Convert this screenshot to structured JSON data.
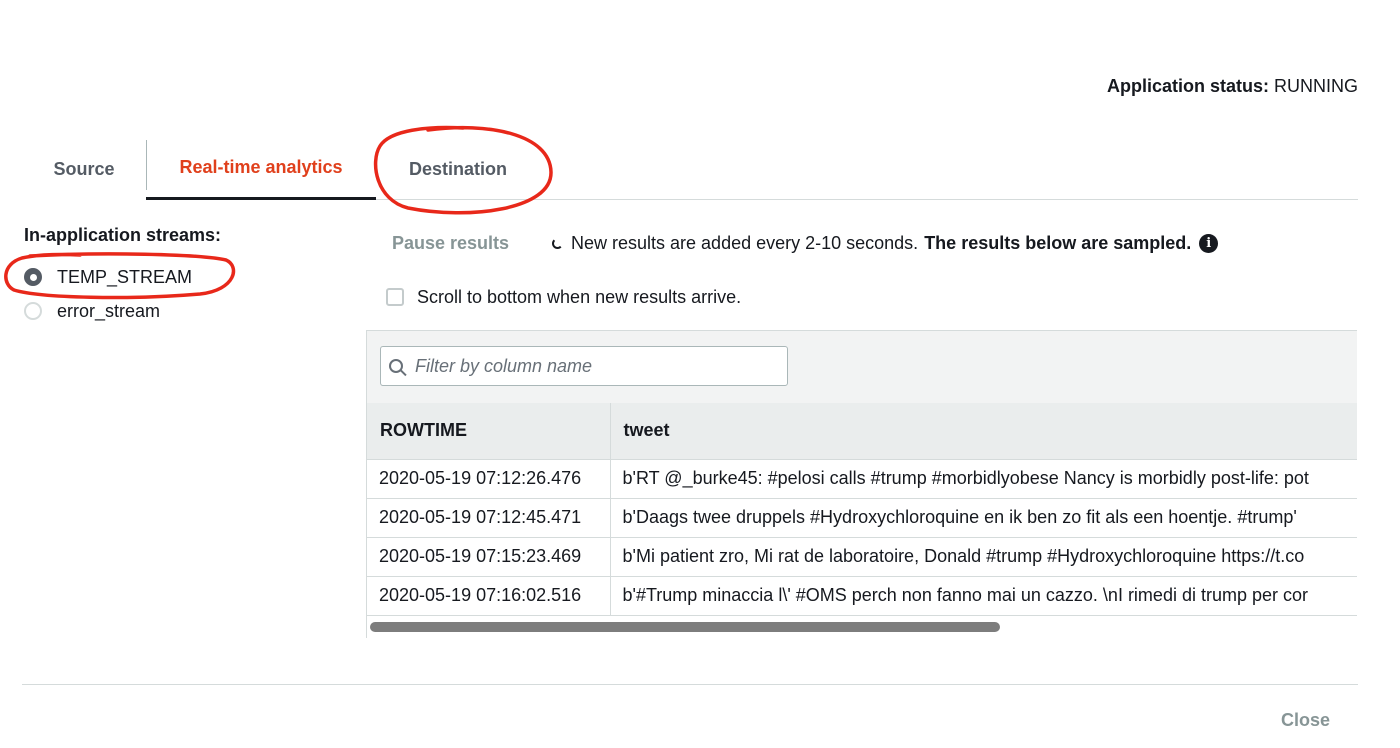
{
  "app_status": {
    "label": "Application status:",
    "value": "RUNNING"
  },
  "tabs": [
    {
      "label": "Source"
    },
    {
      "label": "Real-time analytics",
      "active": true
    },
    {
      "label": "Destination"
    }
  ],
  "streams": {
    "title": "In-application streams:",
    "items": [
      {
        "label": "TEMP_STREAM",
        "selected": true
      },
      {
        "label": "error_stream",
        "selected": false
      }
    ]
  },
  "toolbar": {
    "pause_label": "Pause results",
    "info_text": "New results are added every 2-10 seconds.",
    "info_bold": "The results below are sampled.",
    "scroll_label": "Scroll to bottom when new results arrive."
  },
  "filter": {
    "placeholder": "Filter by column name",
    "value": ""
  },
  "table": {
    "columns": [
      "ROWTIME",
      "tweet"
    ],
    "rows": [
      [
        "2020-05-19 07:12:26.476",
        "b'RT @_burke45: #pelosi calls #trump #morbidlyobese Nancy is morbidly post-life: pot"
      ],
      [
        "2020-05-19 07:12:45.471",
        "b'Daags twee druppels #Hydroxychloroquine en ik ben zo fit als een hoentje. #trump'"
      ],
      [
        "2020-05-19 07:15:23.469",
        "b'Mi patient zro, Mi rat de laboratoire, Donald #trump #Hydroxychloroquine https://t.co"
      ],
      [
        "2020-05-19 07:16:02.516",
        "b'#Trump minaccia l\\' #OMS perch non fanno mai un cazzo. \\nI rimedi di trump per cor"
      ]
    ]
  },
  "footer": {
    "close_label": "Close"
  },
  "colors": {
    "accent": "#e0401c",
    "annotation": "#e8281a"
  }
}
